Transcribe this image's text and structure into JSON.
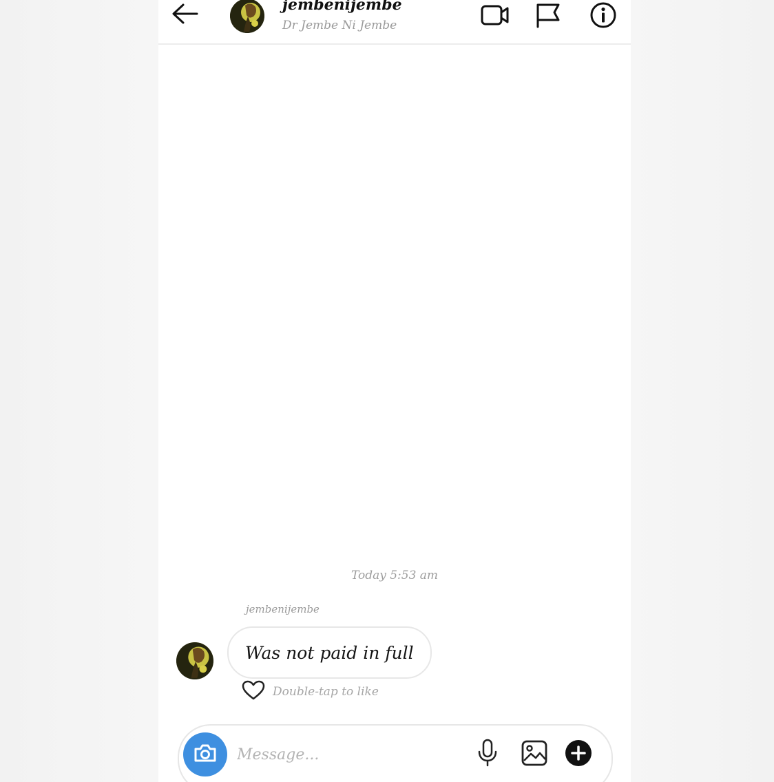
{
  "header": {
    "username": "jembenijembe",
    "display_name": "Dr Jembe Ni Jembe",
    "icons": [
      "back-arrow-icon",
      "video-call-icon",
      "flag-icon",
      "info-icon"
    ]
  },
  "thread": {
    "timestamp": "Today 5:53 am",
    "messages": [
      {
        "sender": "jembenijembe",
        "text": "Was not paid in full",
        "like_hint": "Double-tap to like"
      }
    ]
  },
  "composer": {
    "placeholder": "Message...",
    "icons": [
      "camera-icon",
      "microphone-icon",
      "gallery-icon",
      "plus-icon"
    ]
  },
  "colors": {
    "camera_button": "#3e8fe0",
    "text_primary": "#111111",
    "text_secondary": "#9a9a9a",
    "border": "#e6e6e6"
  }
}
